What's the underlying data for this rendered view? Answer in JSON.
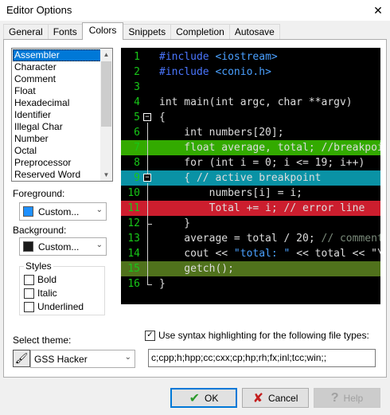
{
  "window": {
    "title": "Editor Options",
    "close_glyph": "✕"
  },
  "tabs": [
    {
      "label": "General",
      "active": false
    },
    {
      "label": "Fonts",
      "active": false
    },
    {
      "label": "Colors",
      "active": true
    },
    {
      "label": "Snippets",
      "active": false
    },
    {
      "label": "Completion",
      "active": false
    },
    {
      "label": "Autosave",
      "active": false
    }
  ],
  "element_list": {
    "items": [
      "Assembler",
      "Character",
      "Comment",
      "Float",
      "Hexadecimal",
      "Identifier",
      "Illegal Char",
      "Number",
      "Octal",
      "Preprocessor",
      "Reserved Word"
    ],
    "selected_index": 0
  },
  "foreground": {
    "label": "Foreground:",
    "value": "Custom...",
    "swatch_color": "#1e90ff"
  },
  "background": {
    "label": "Background:",
    "value": "Custom...",
    "swatch_color": "#1a1a1a"
  },
  "styles": {
    "title": "Styles",
    "bold": {
      "label": "Bold",
      "checked": false
    },
    "italic": {
      "label": "Italic",
      "checked": false
    },
    "underlined": {
      "label": "Underlined",
      "checked": false
    }
  },
  "preview": {
    "fold_open_glyph": "−",
    "lines": [
      {
        "num": "1",
        "text": "#include <iostream>",
        "style": "c-dir",
        "hl": ""
      },
      {
        "num": "2",
        "text": "#include <conio.h>",
        "style": "c-dir",
        "hl": ""
      },
      {
        "num": "3",
        "text": "",
        "style": "c-txt",
        "hl": ""
      },
      {
        "num": "4",
        "text": "int main(int argc, char **argv)",
        "style": "c-txt",
        "hl": ""
      },
      {
        "num": "5",
        "text": "{",
        "style": "c-txt",
        "hl": ""
      },
      {
        "num": "6",
        "text": "    int numbers[20];",
        "style": "c-txt",
        "hl": ""
      },
      {
        "num": "7",
        "text": "    float average, total; //breakpoint",
        "style": "c-txt",
        "hl": "hl-green"
      },
      {
        "num": "8",
        "text": "    for (int i = 0; i <= 19; i++)",
        "style": "c-txt",
        "hl": ""
      },
      {
        "num": "9",
        "text": "    { // active breakpoint",
        "style": "c-txt",
        "hl": "hl-teal"
      },
      {
        "num": "10",
        "text": "        numbers[i] = i;",
        "style": "c-txt",
        "hl": ""
      },
      {
        "num": "11",
        "text": "        Total += i; // error line",
        "style": "c-txt",
        "hl": "hl-red"
      },
      {
        "num": "12",
        "text": "    }",
        "style": "c-txt",
        "hl": ""
      },
      {
        "num": "13",
        "text": "    average = total / 20; // comment",
        "style": "c-txt",
        "hl": ""
      },
      {
        "num": "14",
        "text": "    cout << ",
        "style": "c-txt",
        "hl": "",
        "string": "\"total: \"",
        "after": " << total << \"\\n\";"
      },
      {
        "num": "15",
        "text": "    getch();",
        "style": "c-txt",
        "hl": "hl-olive"
      },
      {
        "num": "16",
        "text": "}",
        "style": "c-txt",
        "hl": ""
      }
    ]
  },
  "theme": {
    "label": "Select theme:",
    "value": "GSS Hacker"
  },
  "syntax_highlighting": {
    "label": "Use syntax highlighting for the following file types:",
    "checked": true,
    "file_types": "c;cpp;h;hpp;cc;cxx;cp;hp;rh;fx;inl;tcc;win;;"
  },
  "buttons": {
    "ok": "OK",
    "cancel": "Cancel",
    "help": "Help"
  },
  "colors": {
    "selection": "#0078d7",
    "line_number": "#18c718"
  }
}
